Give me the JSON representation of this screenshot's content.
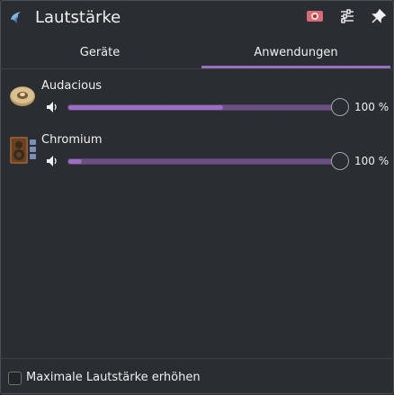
{
  "window": {
    "title": "Lautstärke"
  },
  "header_buttons": [
    {
      "icon": "audio-card-icon"
    },
    {
      "icon": "configure-icon"
    },
    {
      "icon": "pin-icon"
    }
  ],
  "tabs": [
    {
      "label": "Geräte",
      "active": false
    },
    {
      "label": "Anwendungen",
      "active": true
    }
  ],
  "applications": [
    {
      "name": "Audacious",
      "icon": "audacious-icon",
      "volume_percent": 100,
      "volume_label": "100 %",
      "level_meter": 0.58,
      "muted": false
    },
    {
      "name": "Chromium",
      "icon": "chromium-speaker-icon",
      "volume_percent": 100,
      "volume_label": "100 %",
      "level_meter": 0.05,
      "muted": false
    }
  ],
  "footer": {
    "checkbox_label": "Maximale Lautstärke erhöhen",
    "checked": false
  },
  "colors": {
    "accent": "#9b6fc0",
    "background": "#2a2e32",
    "text": "#eff0f1"
  }
}
